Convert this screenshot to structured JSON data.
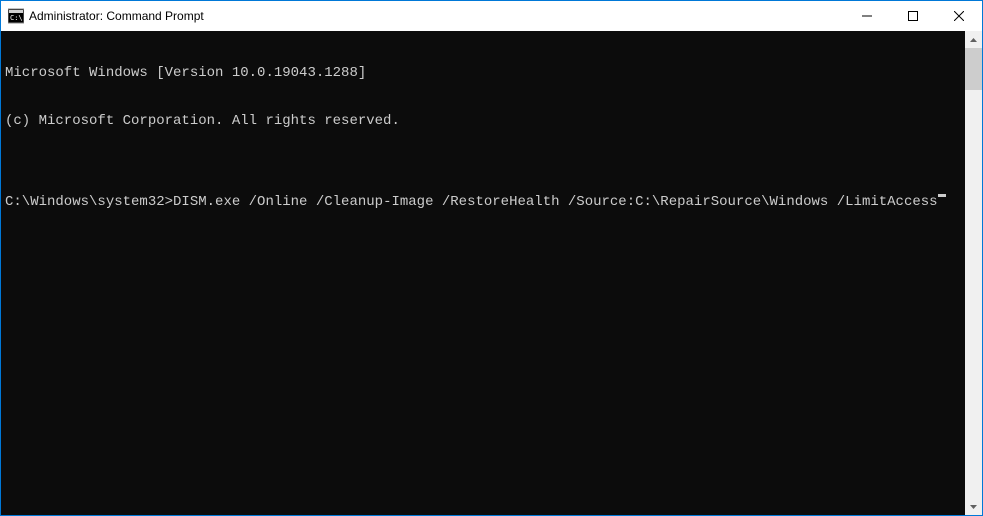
{
  "titlebar": {
    "title": "Administrator: Command Prompt"
  },
  "terminal": {
    "line1": "Microsoft Windows [Version 10.0.19043.1288]",
    "line2": "(c) Microsoft Corporation. All rights reserved.",
    "blank": "",
    "prompt": "C:\\Windows\\system32>",
    "command": "DISM.exe /Online /Cleanup-Image /RestoreHealth /Source:C:\\RepairSource\\Windows /LimitAccess"
  }
}
